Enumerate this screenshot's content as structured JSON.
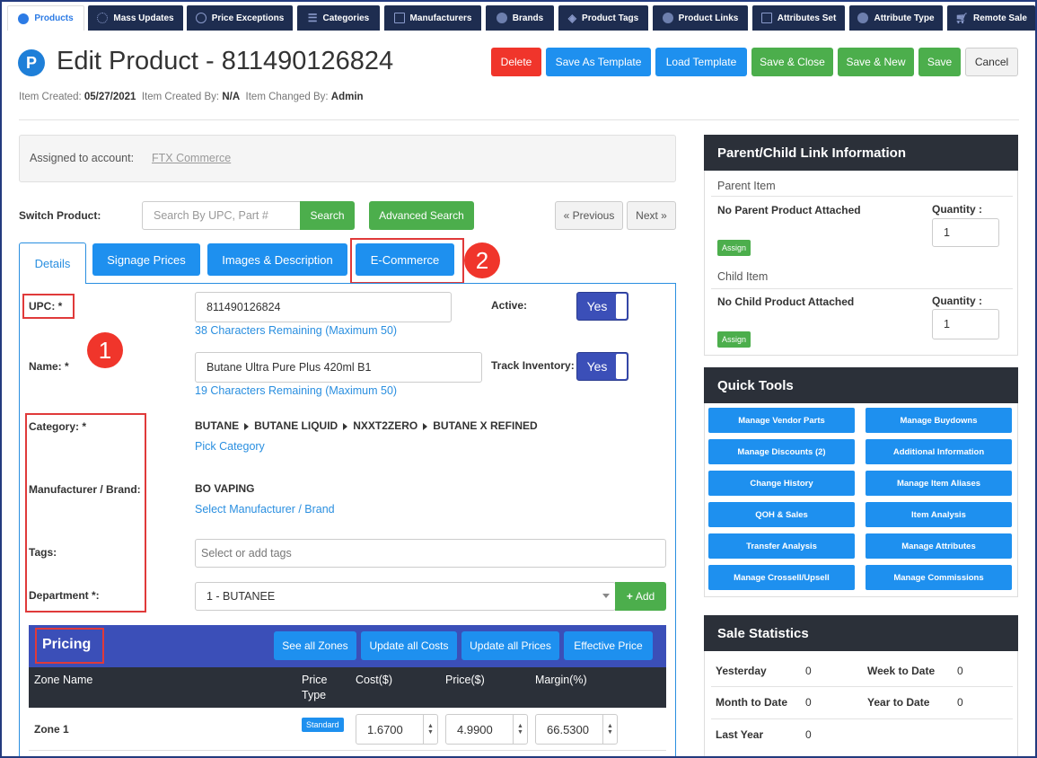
{
  "topnav": {
    "tabs": [
      {
        "label": "Products",
        "icon": "p-circle-icon"
      },
      {
        "label": "Mass Updates",
        "icon": "spinner-icon"
      },
      {
        "label": "Price Exceptions",
        "icon": "search-icon"
      },
      {
        "label": "Categories",
        "icon": "list-icon"
      },
      {
        "label": "Manufacturers",
        "icon": "factory-icon"
      },
      {
        "label": "Brands",
        "icon": "p-circle-icon"
      },
      {
        "label": "Product Tags",
        "icon": "tags-icon"
      },
      {
        "label": "Product Links",
        "icon": "p-circle-icon"
      },
      {
        "label": "Attributes Set",
        "icon": "sitemap-icon"
      },
      {
        "label": "Attribute Type",
        "icon": "p-circle-icon"
      },
      {
        "label": "Remote Sale",
        "icon": "cart-icon"
      }
    ]
  },
  "header": {
    "title": "Edit Product - 811490126824",
    "meta": {
      "created_label": "Item Created:",
      "created_value": "05/27/2021",
      "created_by_label": "Item Created By:",
      "created_by_value": "N/A",
      "changed_by_label": "Item Changed By:",
      "changed_by_value": "Admin"
    },
    "buttons": {
      "delete": "Delete",
      "save_template": "Save As Template",
      "load_template": "Load Template",
      "save_close": "Save & Close",
      "save_new": "Save & New",
      "save": "Save",
      "cancel": "Cancel"
    }
  },
  "account": {
    "label": "Assigned to account:",
    "value": "FTX Commerce"
  },
  "switch": {
    "label": "Switch Product:",
    "placeholder": "Search By UPC, Part #",
    "search": "Search",
    "advanced": "Advanced Search",
    "previous": "« Previous",
    "next": "Next »"
  },
  "tabs": {
    "details": "Details",
    "signage": "Signage Prices",
    "images": "Images & Description",
    "ecommerce": "E-Commerce"
  },
  "annotations": {
    "one": "1",
    "two": "2"
  },
  "form": {
    "upc_label": "UPC: *",
    "upc_value": "811490126824",
    "upc_remaining": "38 Characters Remaining (Maximum 50)",
    "active_label": "Active:",
    "active_value": "Yes",
    "name_label": "Name: *",
    "name_value": "Butane Ultra Pure Plus 420ml B1",
    "name_remaining": "19 Characters Remaining (Maximum 50)",
    "track_label": "Track Inventory:",
    "track_value": "Yes",
    "category_label": "Category: *",
    "category_path": [
      "BUTANE",
      "BUTANE LIQUID",
      "NXXT2ZERO",
      "BUTANE X REFINED"
    ],
    "pick_category": "Pick Category",
    "manufacturer_label": "Manufacturer / Brand:",
    "manufacturer_value": "BO VAPING",
    "select_manufacturer": "Select Manufacturer / Brand",
    "tags_label": "Tags:",
    "tags_placeholder": "Select or add tags",
    "department_label": "Department *:",
    "department_value": "1 - BUTANEE",
    "add": "Add"
  },
  "pricing": {
    "title": "Pricing",
    "buttons": {
      "zones": "See all Zones",
      "costs": "Update all Costs",
      "prices": "Update all Prices",
      "effective": "Effective Price"
    },
    "columns": {
      "zone": "Zone Name",
      "price_type_1": "Price",
      "price_type_2": "Type",
      "cost": "Cost($)",
      "price": "Price($)",
      "margin": "Margin(%)"
    },
    "rows": [
      {
        "zone": "Zone 1",
        "type": "Standard",
        "cost": "1.6700",
        "price": "4.9900",
        "margin": "66.5300"
      }
    ]
  },
  "parent_child": {
    "title": "Parent/Child Link Information",
    "parent_label": "Parent Item",
    "parent_empty": "No Parent Product Attached",
    "child_label": "Child Item",
    "child_empty": "No Child Product Attached",
    "quantity_label": "Quantity :",
    "quantity_value": "1",
    "assign": "Assign"
  },
  "quick_tools": {
    "title": "Quick Tools",
    "buttons": [
      "Manage Vendor Parts",
      "Manage Buydowns",
      "Manage Discounts (2)",
      "Additional Information",
      "Change History",
      "Manage Item Aliases",
      "QOH & Sales",
      "Item Analysis",
      "Transfer Analysis",
      "Manage Attributes",
      "Manage Crossell/Upsell",
      "Manage Commissions"
    ]
  },
  "sale_stats": {
    "title": "Sale Statistics",
    "yesterday_label": "Yesterday",
    "yesterday_value": "0",
    "week_label": "Week to Date",
    "week_value": "0",
    "month_label": "Month to Date",
    "month_value": "0",
    "year_label": "Year to Date",
    "year_value": "0",
    "last_year_label": "Last Year",
    "last_year_value": "0"
  }
}
